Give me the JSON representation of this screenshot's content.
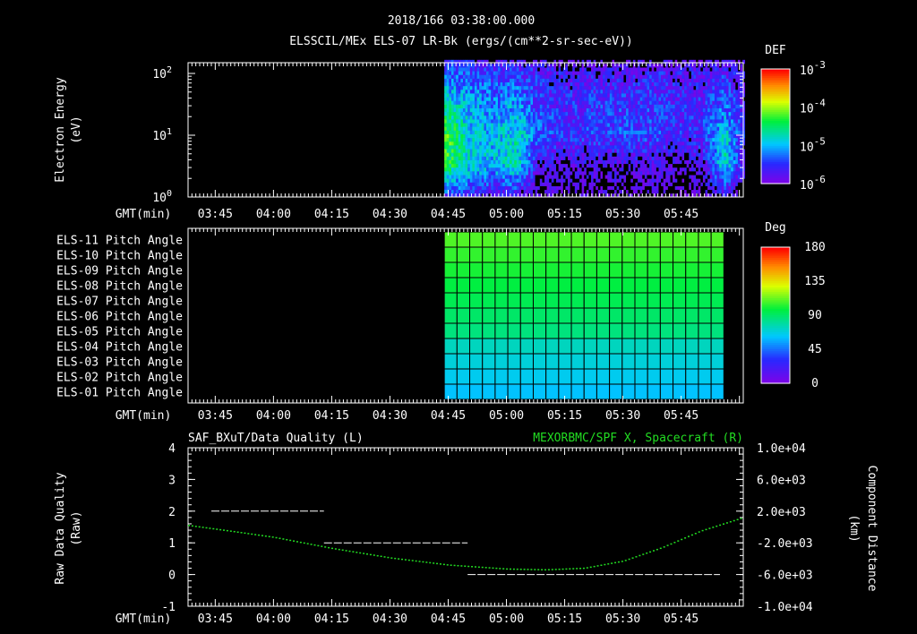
{
  "header": {
    "datetime": "2018/166 03:38:00.000",
    "title": "ELSSCIL/MEx ELS-07 LR-Bk  (ergs/(cm**2-sr-sec-eV))"
  },
  "chart_data": [
    {
      "type": "heatmap",
      "panel": "spectrogram",
      "ylabel": [
        "Electron Energy",
        "(eV)"
      ],
      "yscale": "log",
      "ylim": [
        1,
        150
      ],
      "yticks": [
        "10^0",
        "10^1",
        "10^2"
      ],
      "xlabel": "GMT(min)",
      "xlim_min": [
        218,
        361
      ],
      "xticks": [
        "03:45",
        "04:00",
        "04:15",
        "04:30",
        "04:45",
        "05:00",
        "05:15",
        "05:30",
        "05:45"
      ],
      "xtick_min": [
        225,
        240,
        255,
        270,
        285,
        300,
        315,
        330,
        345
      ],
      "data_start_min": 284,
      "colorbar": {
        "label": "DEF",
        "ticks": [
          "10^-3",
          "10^-4",
          "10^-5",
          "10^-6"
        ],
        "range_log10": [
          -6,
          -3
        ]
      },
      "coarse_log10_def": {
        "time_min": [
          284,
          290,
          296,
          302,
          308,
          314,
          320,
          326,
          332,
          338,
          344,
          350,
          356,
          361
        ],
        "energy_log10": [
          0,
          0.5,
          1,
          1.5,
          2,
          2.2
        ],
        "values": [
          [
            -5.5,
            -4.3,
            -4.2,
            -4.8,
            -5.3,
            -5.6
          ],
          [
            -5.6,
            -4.8,
            -4.9,
            -5.0,
            -5.4,
            -5.7
          ],
          [
            -5.7,
            -5.0,
            -5.0,
            -5.2,
            -5.5,
            -5.8
          ],
          [
            -5.7,
            -4.7,
            -4.8,
            -5.1,
            -5.5,
            -5.8
          ],
          [
            -6.0,
            -5.7,
            -5.3,
            -5.5,
            -5.6,
            -5.9
          ],
          [
            -6.0,
            -5.8,
            -5.5,
            -5.6,
            -5.7,
            -6.0
          ],
          [
            -6.0,
            -5.8,
            -5.5,
            -5.5,
            -5.7,
            -6.0
          ],
          [
            -6.0,
            -5.8,
            -5.4,
            -5.5,
            -5.7,
            -6.0
          ],
          [
            -6.0,
            -5.8,
            -5.4,
            -5.5,
            -5.7,
            -6.0
          ],
          [
            -6.0,
            -5.8,
            -5.4,
            -5.5,
            -5.6,
            -6.0
          ],
          [
            -6.0,
            -5.9,
            -5.6,
            -5.6,
            -5.7,
            -6.0
          ],
          [
            -6.0,
            -5.8,
            -5.5,
            -5.6,
            -5.7,
            -6.0
          ],
          [
            -5.7,
            -4.8,
            -4.9,
            -5.3,
            -5.6,
            -5.9
          ],
          [
            -6.0,
            -5.8,
            -5.6,
            -5.7,
            -5.8,
            -6.0
          ]
        ]
      }
    },
    {
      "type": "heatmap",
      "panel": "pitch-angle",
      "row_labels": [
        "ELS-11 Pitch Angle",
        "ELS-10 Pitch Angle",
        "ELS-09 Pitch Angle",
        "ELS-08 Pitch Angle",
        "ELS-07 Pitch Angle",
        "ELS-06 Pitch Angle",
        "ELS-05 Pitch Angle",
        "ELS-04 Pitch Angle",
        "ELS-03 Pitch Angle",
        "ELS-02 Pitch Angle",
        "ELS-01 Pitch Angle"
      ],
      "row_values_deg": [
        110,
        106,
        102,
        98,
        95,
        91,
        87,
        75,
        70,
        66,
        62
      ],
      "data_start_min": 284,
      "data_end_min": 356,
      "columns": 22,
      "xlabel": "GMT(min)",
      "colorbar": {
        "label": "Deg",
        "ticks": [
          "180",
          "135",
          "90",
          "45",
          "0"
        ],
        "range": [
          0,
          180
        ]
      }
    },
    {
      "type": "line",
      "panel": "quality-position",
      "title_left": "SAF_BXuT/Data Quality (L)",
      "title_right": "MEXORBMC/SPF X, Spacecraft (R)",
      "ylabel_left": [
        "Raw Data Quality",
        "(Raw)"
      ],
      "ylabel_right": [
        "Component Distance",
        "(km)"
      ],
      "ylim_left": [
        -1,
        4
      ],
      "yticks_left": [
        "4",
        "3",
        "2",
        "1",
        "0",
        "-1"
      ],
      "ylim_right": [
        -10000,
        10000
      ],
      "yticks_right": [
        "1.0e+04",
        "6.0e+03",
        "2.0e+03",
        "-2.0e+03",
        "-6.0e+03",
        "-1.0e+04"
      ],
      "xlabel": "GMT(min)",
      "series": [
        {
          "name": "Data Quality",
          "color": "#ffffff",
          "segments": [
            {
              "x": [
                224,
                253
              ],
              "y": 2
            },
            {
              "x": [
                253,
                290
              ],
              "y": 1
            },
            {
              "x": [
                290,
                355
              ],
              "y": 0
            }
          ]
        },
        {
          "name": "SPF X",
          "color": "#22dd22",
          "x": [
            218,
            230,
            240,
            255,
            270,
            285,
            300,
            310,
            320,
            330,
            340,
            350,
            361
          ],
          "y": [
            200,
            -600,
            -1300,
            -2700,
            -3900,
            -4800,
            -5300,
            -5400,
            -5200,
            -4300,
            -2600,
            -500,
            1200
          ]
        }
      ]
    }
  ]
}
